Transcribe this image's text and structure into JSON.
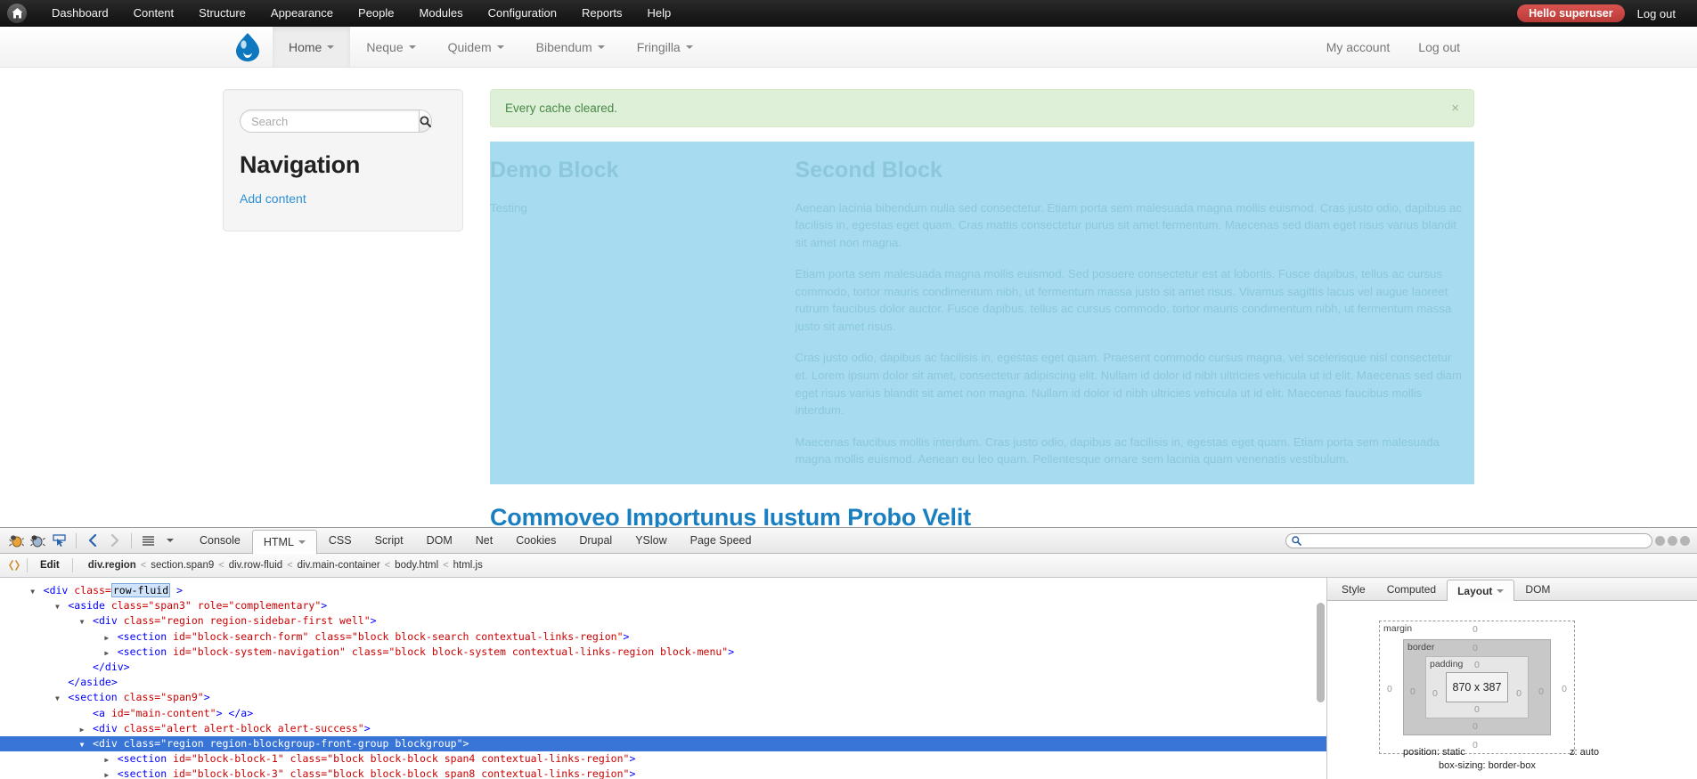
{
  "admin_toolbar": {
    "home_icon": "home-icon",
    "items": [
      {
        "label": "Dashboard"
      },
      {
        "label": "Content"
      },
      {
        "label": "Structure"
      },
      {
        "label": "Appearance"
      },
      {
        "label": "People"
      },
      {
        "label": "Modules"
      },
      {
        "label": "Configuration"
      },
      {
        "label": "Reports"
      },
      {
        "label": "Help"
      }
    ],
    "hello_badge": "Hello superuser",
    "logout": "Log out",
    "badge_color": "#d9534f"
  },
  "site_navbar": {
    "brand_icon": "drupal-drop-logo",
    "menu": [
      {
        "label": "Home",
        "active": true,
        "has_caret": true
      },
      {
        "label": "Neque",
        "active": false,
        "has_caret": true
      },
      {
        "label": "Quidem",
        "active": false,
        "has_caret": true
      },
      {
        "label": "Bibendum",
        "active": false,
        "has_caret": true
      },
      {
        "label": "Fringilla",
        "active": false,
        "has_caret": true
      }
    ],
    "right": [
      {
        "label": "My account"
      },
      {
        "label": "Log out"
      }
    ]
  },
  "sidebar": {
    "search": {
      "placeholder": "Search",
      "value": "",
      "button_icon": "search-icon"
    },
    "nav_title": "Navigation",
    "add_content": "Add content"
  },
  "main": {
    "alert": {
      "text": "Every cache cleared.",
      "close_label": "×",
      "bg_color": "#dff0d8",
      "text_color": "#468847"
    },
    "blockgroup": {
      "bg_color": "#a7dcf0",
      "text_color": "#8cc7dd",
      "block_one": {
        "title": "Demo Block",
        "paragraphs": [
          "Testing"
        ]
      },
      "block_two": {
        "title": "Second Block",
        "paragraphs": [
          "Aenean lacinia bibendum nulla sed consectetur. Etiam porta sem malesuada magna mollis euismod. Cras justo odio, dapibus ac facilisis in, egestas eget quam. Cras mattis consectetur purus sit amet fermentum. Maecenas sed diam eget risus varius blandit sit amet non magna.",
          "Etiam porta sem malesuada magna mollis euismod. Sed posuere consectetur est at lobortis. Fusce dapibus, tellus ac cursus commodo, tortor mauris condimentum nibh, ut fermentum massa justo sit amet risus. Vivamus sagittis lacus vel augue laoreet rutrum faucibus dolor auctor. Fusce dapibus, tellus ac cursus commodo, tortor mauris condimentum nibh, ut fermentum massa justo sit amet risus.",
          "Cras justo odio, dapibus ac facilisis in, egestas eget quam. Praesent commodo cursus magna, vel scelerisque nisl consectetur et. Lorem ipsum dolor sit amet, consectetur adipiscing elit. Nullam id dolor id nibh ultricies vehicula ut id elit. Maecenas sed diam eget risus varius blandit sit amet non magna. Nullam id dolor id nibh ultricies vehicula ut id elit. Maecenas faucibus mollis interdum.",
          "Maecenas faucibus mollis interdum. Cras justo odio, dapibus ac facilisis in, egestas eget quam. Etiam porta sem malesuada magna mollis euismod. Aenean eu leo quam. Pellentesque ornare sem lacinia quam venenatis vestibulum."
        ]
      }
    },
    "page_heading": "Commoveo Importunus Iustum Probo Velit",
    "heading_color": "#1a7fc1"
  },
  "firebug": {
    "icons": [
      {
        "name": "firebug-bug-icon"
      },
      {
        "name": "firebug-deactivate-icon"
      },
      {
        "name": "inspect-element-icon"
      },
      {
        "name": "previous-arrow-icon"
      },
      {
        "name": "next-arrow-icon"
      },
      {
        "name": "menu-lines-icon"
      },
      {
        "name": "options-caret-icon"
      }
    ],
    "tabs": [
      {
        "label": "Console",
        "active": false,
        "caret": false
      },
      {
        "label": "HTML",
        "active": true,
        "caret": true
      },
      {
        "label": "CSS",
        "active": false,
        "caret": false
      },
      {
        "label": "Script",
        "active": false,
        "caret": false
      },
      {
        "label": "DOM",
        "active": false,
        "caret": false
      },
      {
        "label": "Net",
        "active": false,
        "caret": false
      },
      {
        "label": "Cookies",
        "active": false,
        "caret": false
      },
      {
        "label": "Drupal",
        "active": false,
        "caret": false
      },
      {
        "label": "YSlow",
        "active": false,
        "caret": false
      },
      {
        "label": "Page Speed",
        "active": false,
        "caret": false
      }
    ],
    "search": {
      "placeholder": "",
      "value": "",
      "icon": "search-icon"
    },
    "window_buttons": [
      "minimize-icon",
      "maximize-icon",
      "close-icon"
    ],
    "breadcrumb_bar": {
      "panel_icon": "html-panel-icon",
      "edit_label": "Edit",
      "crumbs": [
        {
          "label": "div.region"
        },
        {
          "label": "section.span9"
        },
        {
          "label": "div.row-fluid"
        },
        {
          "label": "div.main-container"
        },
        {
          "label": "body.html"
        },
        {
          "label": "html.js"
        }
      ],
      "separator": "<"
    },
    "html_tree": [
      {
        "indent": 0,
        "twisty": "down",
        "selected": false,
        "segments": [
          {
            "t": "punc",
            "s": "<"
          },
          {
            "t": "tag",
            "s": "div"
          },
          {
            "t": "plain",
            "s": " "
          },
          {
            "t": "attr",
            "s": "class="
          },
          {
            "t": "edit",
            "s": "row-fluid"
          },
          {
            "t": "punc",
            "s": " >"
          }
        ]
      },
      {
        "indent": 1,
        "twisty": "down",
        "selected": false,
        "segments": [
          {
            "t": "punc",
            "s": "<"
          },
          {
            "t": "tag",
            "s": "aside"
          },
          {
            "t": "plain",
            "s": " "
          },
          {
            "t": "attr",
            "s": "class="
          },
          {
            "t": "val",
            "s": "\"span3\""
          },
          {
            "t": "plain",
            "s": " "
          },
          {
            "t": "attr",
            "s": "role="
          },
          {
            "t": "val",
            "s": "\"complementary\""
          },
          {
            "t": "punc",
            "s": ">"
          }
        ]
      },
      {
        "indent": 2,
        "twisty": "down",
        "selected": false,
        "segments": [
          {
            "t": "punc",
            "s": "<"
          },
          {
            "t": "tag",
            "s": "div"
          },
          {
            "t": "plain",
            "s": " "
          },
          {
            "t": "attr",
            "s": "class="
          },
          {
            "t": "val",
            "s": "\"region region-sidebar-first well\""
          },
          {
            "t": "punc",
            "s": ">"
          }
        ]
      },
      {
        "indent": 3,
        "twisty": "right",
        "selected": false,
        "segments": [
          {
            "t": "punc",
            "s": "<"
          },
          {
            "t": "tag",
            "s": "section"
          },
          {
            "t": "plain",
            "s": " "
          },
          {
            "t": "attr",
            "s": "id="
          },
          {
            "t": "val",
            "s": "\"block-search-form\""
          },
          {
            "t": "plain",
            "s": " "
          },
          {
            "t": "attr",
            "s": "class="
          },
          {
            "t": "val",
            "s": "\"block block-search contextual-links-region\""
          },
          {
            "t": "punc",
            "s": ">"
          }
        ]
      },
      {
        "indent": 3,
        "twisty": "right",
        "selected": false,
        "segments": [
          {
            "t": "punc",
            "s": "<"
          },
          {
            "t": "tag",
            "s": "section"
          },
          {
            "t": "plain",
            "s": " "
          },
          {
            "t": "attr",
            "s": "id="
          },
          {
            "t": "val",
            "s": "\"block-system-navigation\""
          },
          {
            "t": "plain",
            "s": " "
          },
          {
            "t": "attr",
            "s": "class="
          },
          {
            "t": "val",
            "s": "\"block block-system contextual-links-region block-menu\""
          },
          {
            "t": "punc",
            "s": ">"
          }
        ]
      },
      {
        "indent": 2,
        "twisty": "none",
        "selected": false,
        "segments": [
          {
            "t": "punc",
            "s": "</"
          },
          {
            "t": "tag",
            "s": "div"
          },
          {
            "t": "punc",
            "s": ">"
          }
        ]
      },
      {
        "indent": 1,
        "twisty": "none",
        "selected": false,
        "segments": [
          {
            "t": "punc",
            "s": "</"
          },
          {
            "t": "tag",
            "s": "aside"
          },
          {
            "t": "punc",
            "s": ">"
          }
        ]
      },
      {
        "indent": 1,
        "twisty": "down",
        "selected": false,
        "segments": [
          {
            "t": "punc",
            "s": "<"
          },
          {
            "t": "tag",
            "s": "section"
          },
          {
            "t": "plain",
            "s": " "
          },
          {
            "t": "attr",
            "s": "class="
          },
          {
            "t": "val",
            "s": "\"span9\""
          },
          {
            "t": "punc",
            "s": ">"
          }
        ]
      },
      {
        "indent": 2,
        "twisty": "none",
        "selected": false,
        "segments": [
          {
            "t": "punc",
            "s": "<"
          },
          {
            "t": "tag",
            "s": "a"
          },
          {
            "t": "plain",
            "s": " "
          },
          {
            "t": "attr",
            "s": "id="
          },
          {
            "t": "val",
            "s": "\"main-content\""
          },
          {
            "t": "punc",
            "s": "> </"
          },
          {
            "t": "tag",
            "s": "a"
          },
          {
            "t": "punc",
            "s": ">"
          }
        ]
      },
      {
        "indent": 2,
        "twisty": "right",
        "selected": false,
        "segments": [
          {
            "t": "punc",
            "s": "<"
          },
          {
            "t": "tag",
            "s": "div"
          },
          {
            "t": "plain",
            "s": " "
          },
          {
            "t": "attr",
            "s": "class="
          },
          {
            "t": "val",
            "s": "\"alert alert-block alert-success\""
          },
          {
            "t": "punc",
            "s": ">"
          }
        ]
      },
      {
        "indent": 2,
        "twisty": "down",
        "selected": true,
        "segments": [
          {
            "t": "punc",
            "s": "<"
          },
          {
            "t": "tag",
            "s": "div"
          },
          {
            "t": "plain",
            "s": " "
          },
          {
            "t": "attr",
            "s": "class="
          },
          {
            "t": "val",
            "s": "\"region region-blockgroup-front-group blockgroup\""
          },
          {
            "t": "punc",
            "s": ">"
          }
        ]
      },
      {
        "indent": 3,
        "twisty": "right",
        "selected": false,
        "segments": [
          {
            "t": "punc",
            "s": "<"
          },
          {
            "t": "tag",
            "s": "section"
          },
          {
            "t": "plain",
            "s": " "
          },
          {
            "t": "attr",
            "s": "id="
          },
          {
            "t": "val",
            "s": "\"block-block-1\""
          },
          {
            "t": "plain",
            "s": " "
          },
          {
            "t": "attr",
            "s": "class="
          },
          {
            "t": "val",
            "s": "\"block block-block span4 contextual-links-region\""
          },
          {
            "t": "punc",
            "s": ">"
          }
        ]
      },
      {
        "indent": 3,
        "twisty": "right",
        "selected": false,
        "segments": [
          {
            "t": "punc",
            "s": "<"
          },
          {
            "t": "tag",
            "s": "section"
          },
          {
            "t": "plain",
            "s": " "
          },
          {
            "t": "attr",
            "s": "id="
          },
          {
            "t": "val",
            "s": "\"block-block-3\""
          },
          {
            "t": "plain",
            "s": " "
          },
          {
            "t": "attr",
            "s": "class="
          },
          {
            "t": "val",
            "s": "\"block block-block span8 contextual-links-region\""
          },
          {
            "t": "punc",
            "s": ">"
          }
        ]
      }
    ],
    "side_tabs": [
      {
        "label": "Style",
        "active": false,
        "caret": false
      },
      {
        "label": "Computed",
        "active": false,
        "caret": false
      },
      {
        "label": "Layout",
        "active": true,
        "caret": true
      },
      {
        "label": "DOM",
        "active": false,
        "caret": false
      }
    ],
    "layout": {
      "margin_label": "margin",
      "border_label": "border",
      "padding_label": "padding",
      "content_size": "870 x 387",
      "margin_top": "0",
      "margin_right": "0",
      "margin_bottom": "0",
      "margin_left": "0",
      "border_top": "0",
      "border_right": "0",
      "border_bottom": "0",
      "border_left": "0",
      "padding_top": "0",
      "padding_right": "0",
      "padding_bottom": "0",
      "padding_left": "0",
      "position": "position: static",
      "z_index": "z: auto",
      "box_sizing": "box-sizing: border-box"
    }
  }
}
